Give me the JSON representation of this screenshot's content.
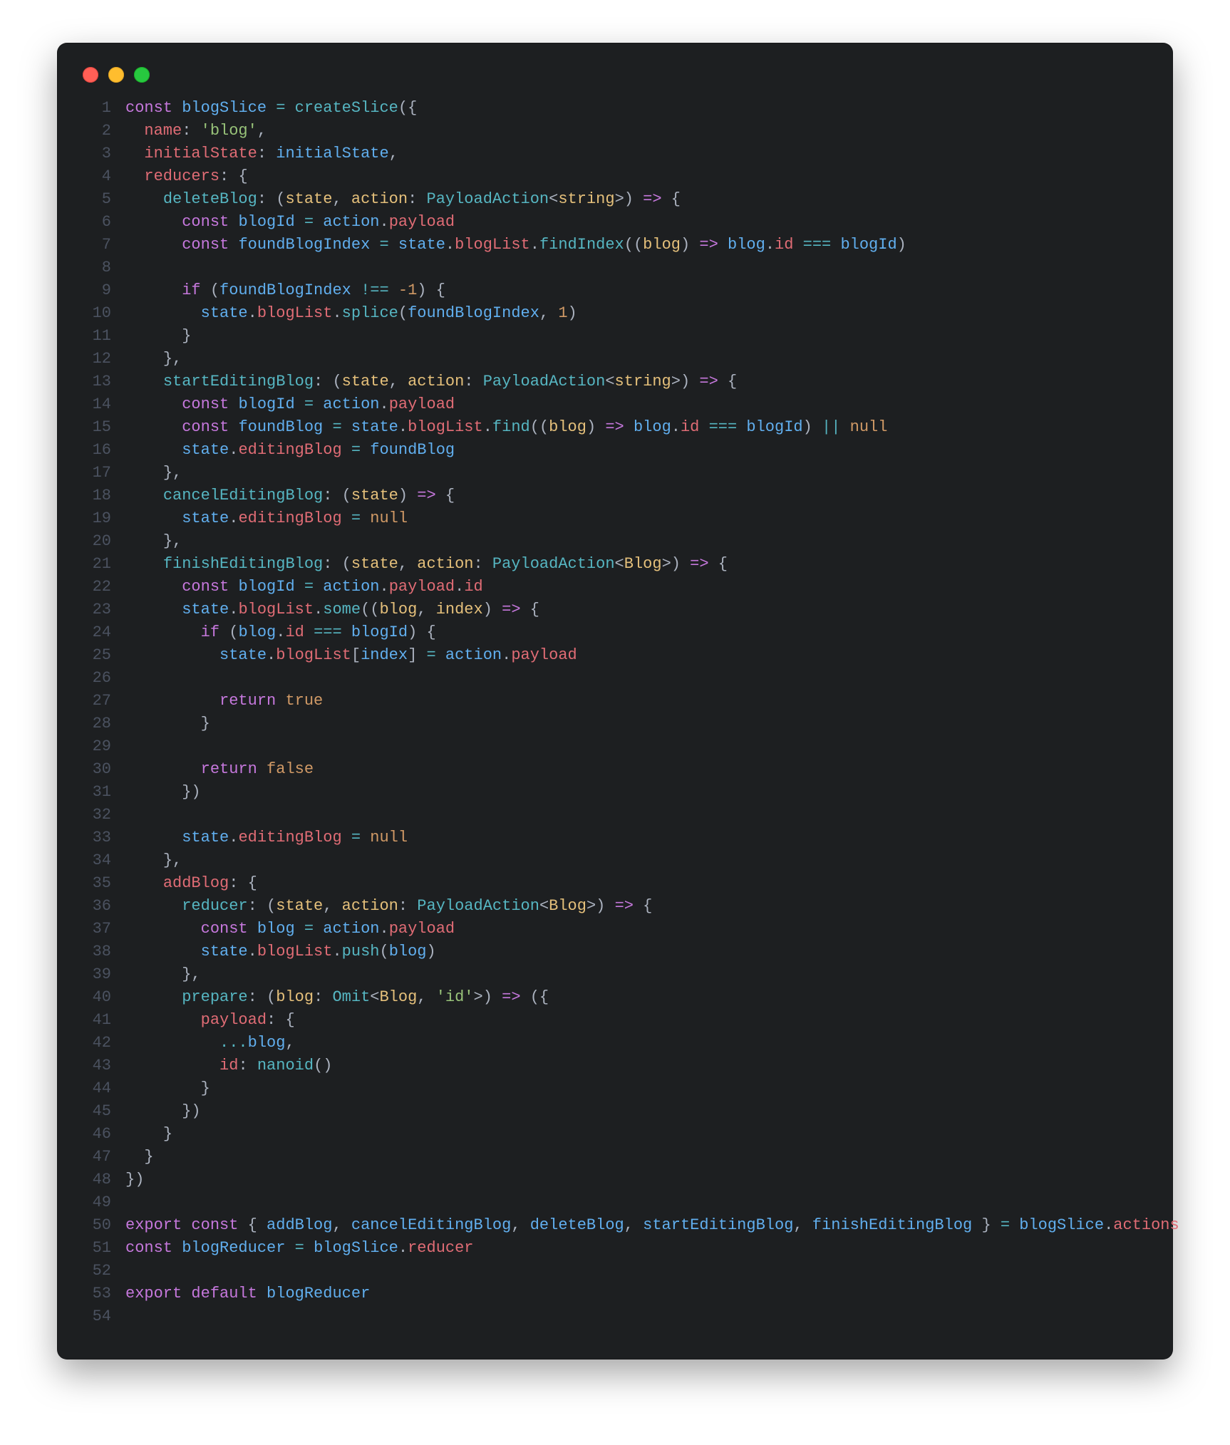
{
  "window": {
    "traffic_light_colors": {
      "red": "#ff5f56",
      "yellow": "#ffbd2e",
      "green": "#27c93f"
    }
  },
  "tokens": {
    "const": "const",
    "if": "if",
    "return": "return",
    "export": "export",
    "default": "default",
    "arrow": "=>",
    "eq": "=",
    "eqeqeq": "===",
    "neqeq": "!==",
    "oror": "||",
    "spread": "...",
    "null": "null",
    "true": "true",
    "false": "false",
    "minus1": "-1",
    "one": "1"
  },
  "names": {
    "blogSlice": "blogSlice",
    "createSlice": "createSlice",
    "name": "name",
    "blog_str": "'blog'",
    "initialState_key": "initialState",
    "initialState_val": "initialState",
    "reducers": "reducers",
    "deleteBlog": "deleteBlog",
    "startEditingBlog": "startEditingBlog",
    "cancelEditingBlog": "cancelEditingBlog",
    "finishEditingBlog": "finishEditingBlog",
    "addBlog": "addBlog",
    "reducer": "reducer",
    "prepare": "prepare",
    "state": "state",
    "action": "action",
    "PayloadAction": "PayloadAction",
    "string": "string",
    "Blog": "Blog",
    "Omit": "Omit",
    "id_str": "'id'",
    "blogId": "blogId",
    "payload": "payload",
    "foundBlogIndex": "foundBlogIndex",
    "foundBlog": "foundBlog",
    "blogList": "blogList",
    "findIndex": "findIndex",
    "find": "find",
    "splice": "splice",
    "some": "some",
    "push": "push",
    "editingBlog": "editingBlog",
    "blog": "blog",
    "index": "index",
    "id": "id",
    "nanoid": "nanoid",
    "addBlog_id": "addBlog",
    "cancelEditingBlog_id": "cancelEditingBlog",
    "deleteBlog_id": "deleteBlog",
    "startEditingBlog_id": "startEditingBlog",
    "finishEditingBlog_id": "finishEditingBlog",
    "actions": "actions",
    "blogReducer": "blogReducer",
    "reducer_prop": "reducer"
  },
  "line_numbers": [
    "1",
    "2",
    "3",
    "4",
    "5",
    "6",
    "7",
    "8",
    "9",
    "10",
    "11",
    "12",
    "13",
    "14",
    "15",
    "16",
    "17",
    "18",
    "19",
    "20",
    "21",
    "22",
    "23",
    "24",
    "25",
    "26",
    "27",
    "28",
    "29",
    "30",
    "31",
    "32",
    "33",
    "34",
    "35",
    "36",
    "37",
    "38",
    "39",
    "40",
    "41",
    "42",
    "43",
    "44",
    "45",
    "46",
    "47",
    "48",
    "49",
    "50",
    "51",
    "52",
    "53",
    "54"
  ],
  "raw_code": "const blogSlice = createSlice({\n  name: 'blog',\n  initialState: initialState,\n  reducers: {\n    deleteBlog: (state, action: PayloadAction<string>) => {\n      const blogId = action.payload\n      const foundBlogIndex = state.blogList.findIndex((blog) => blog.id === blogId)\n\n      if (foundBlogIndex !== -1) {\n        state.blogList.splice(foundBlogIndex, 1)\n      }\n    },\n    startEditingBlog: (state, action: PayloadAction<string>) => {\n      const blogId = action.payload\n      const foundBlog = state.blogList.find((blog) => blog.id === blogId) || null\n      state.editingBlog = foundBlog\n    },\n    cancelEditingBlog: (state) => {\n      state.editingBlog = null\n    },\n    finishEditingBlog: (state, action: PayloadAction<Blog>) => {\n      const blogId = action.payload.id\n      state.blogList.some((blog, index) => {\n        if (blog.id === blogId) {\n          state.blogList[index] = action.payload\n\n          return true\n        }\n\n        return false\n      })\n\n      state.editingBlog = null\n    },\n    addBlog: {\n      reducer: (state, action: PayloadAction<Blog>) => {\n        const blog = action.payload\n        state.blogList.push(blog)\n      },\n      prepare: (blog: Omit<Blog, 'id'>) => ({\n        payload: {\n          ...blog,\n          id: nanoid()\n        }\n      })\n    }\n  }\n})\n\nexport const { addBlog, cancelEditingBlog, deleteBlog, startEditingBlog, finishEditingBlog } = blogSlice.actions\nconst blogReducer = blogSlice.reducer\n\nexport default blogReducer\n"
}
